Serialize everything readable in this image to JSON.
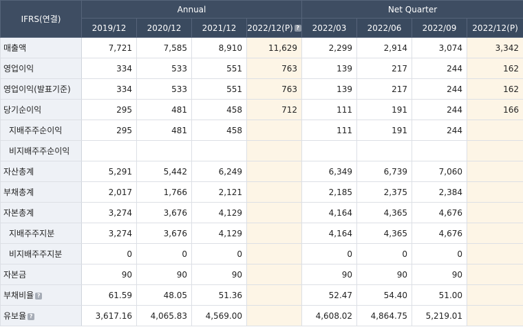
{
  "header": {
    "corner": "IFRS(연결)",
    "group_annual": "Annual",
    "group_quarter": "Net Quarter",
    "columns": [
      "2019/12",
      "2020/12",
      "2021/12",
      "2022/12(P)",
      "2022/03",
      "2022/06",
      "2022/09",
      "2022/12(P)"
    ]
  },
  "rows": [
    {
      "label": "매출액",
      "values": [
        "7,721",
        "7,585",
        "8,910",
        "11,629",
        "2,299",
        "2,914",
        "3,074",
        "3,342"
      ]
    },
    {
      "label": "영업이익",
      "values": [
        "334",
        "533",
        "551",
        "763",
        "139",
        "217",
        "244",
        "162"
      ]
    },
    {
      "label": "영업이익(발표기준)",
      "values": [
        "334",
        "533",
        "551",
        "763",
        "139",
        "217",
        "244",
        "162"
      ]
    },
    {
      "label": "당기순이익",
      "values": [
        "295",
        "481",
        "458",
        "712",
        "111",
        "191",
        "244",
        "166"
      ]
    },
    {
      "label": "지배주주순이익",
      "values": [
        "295",
        "481",
        "458",
        "",
        "111",
        "191",
        "244",
        ""
      ]
    },
    {
      "label": "비지배주주순이익",
      "values": [
        "",
        "",
        "",
        "",
        "",
        "",
        "",
        ""
      ]
    },
    {
      "label": "자산총계",
      "values": [
        "5,291",
        "5,442",
        "6,249",
        "",
        "6,349",
        "6,739",
        "7,060",
        ""
      ]
    },
    {
      "label": "부채총계",
      "values": [
        "2,017",
        "1,766",
        "2,121",
        "",
        "2,185",
        "2,375",
        "2,384",
        ""
      ]
    },
    {
      "label": "자본총계",
      "values": [
        "3,274",
        "3,676",
        "4,129",
        "",
        "4,164",
        "4,365",
        "4,676",
        ""
      ]
    },
    {
      "label": "지배주주지분",
      "values": [
        "3,274",
        "3,676",
        "4,129",
        "",
        "4,164",
        "4,365",
        "4,676",
        ""
      ]
    },
    {
      "label": "비지배주주지분",
      "values": [
        "0",
        "0",
        "0",
        "",
        "0",
        "0",
        "0",
        ""
      ]
    },
    {
      "label": "자본금",
      "values": [
        "90",
        "90",
        "90",
        "",
        "90",
        "90",
        "90",
        ""
      ]
    },
    {
      "label": "부채비율",
      "values": [
        "61.59",
        "48.05",
        "51.36",
        "",
        "52.47",
        "54.40",
        "51.00",
        ""
      ]
    },
    {
      "label": "유보율",
      "values": [
        "3,617.16",
        "4,065.83",
        "4,569.00",
        "",
        "4,608.02",
        "4,864.75",
        "5,219.01",
        ""
      ]
    }
  ],
  "help_glyph": "?"
}
